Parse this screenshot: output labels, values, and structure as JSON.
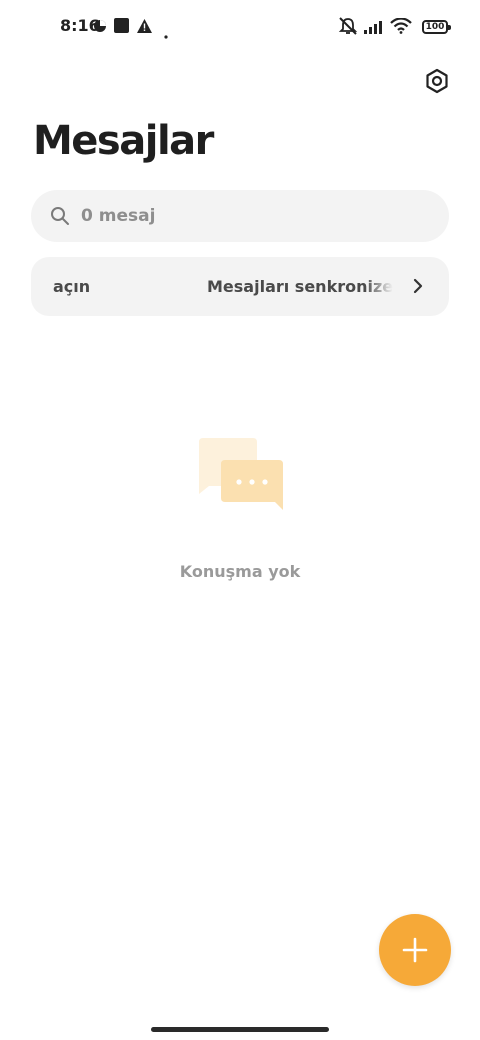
{
  "status_bar": {
    "time": "8:16",
    "battery": "100"
  },
  "header": {
    "title": "Mesajlar"
  },
  "search": {
    "placeholder": "0 mesaj"
  },
  "sync_banner": {
    "left_text": "açın",
    "text": "Mesajları senkronize et"
  },
  "empty_state": {
    "text": "Konuşma yok"
  },
  "colors": {
    "accent": "#f6a938",
    "background": "#ffffff",
    "surface": "#f3f3f3"
  },
  "icons": {
    "settings": "settings-gear-icon",
    "search": "search-icon",
    "chevron": "chevron-right-icon",
    "fab": "plus-icon",
    "empty": "chat-bubbles-icon"
  }
}
